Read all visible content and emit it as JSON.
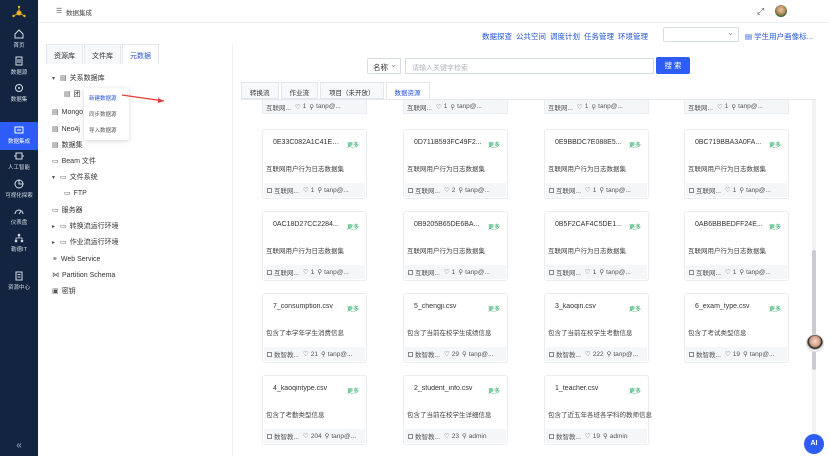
{
  "header": {
    "title": "数据集成"
  },
  "sidebar": {
    "items": [
      {
        "label": "首页",
        "icon": "home-icon"
      },
      {
        "label": "数据源",
        "icon": "database-icon"
      },
      {
        "label": "数据集",
        "icon": "dataset-icon"
      },
      {
        "label": "数据集成",
        "icon": "integration-icon"
      },
      {
        "label": "人工智能",
        "icon": "ai-icon"
      },
      {
        "label": "可视化探索",
        "icon": "chart-icon"
      },
      {
        "label": "仪表盘",
        "icon": "dashboard-icon"
      },
      {
        "label": "勒德IT",
        "icon": "org-icon"
      },
      {
        "label": "资源中心",
        "icon": "resource-icon"
      }
    ],
    "active_index": 3
  },
  "toplinks": [
    "数据探查",
    "公共空间",
    "调度计划",
    "任务管理",
    "环境管理"
  ],
  "profile_link": "学生用户画像标...",
  "left_tabs": [
    "资源库",
    "文件库",
    "元数据"
  ],
  "left_active_tab": 2,
  "tree": {
    "relational": "关系数据库",
    "group_child": "团",
    "mongo": "Mongo",
    "neo4j": "Neo4j",
    "dataset": "数据集",
    "beam": "Beam 文件",
    "filesystem": "文件系统",
    "ftp": "FTP",
    "server": "服务器",
    "convert_env": "转换流运行环境",
    "job_env": "作业流运行环境",
    "web_service": "Web Service",
    "partition_schema": "Partition Schema",
    "key": "密钥"
  },
  "context_menu": [
    "新建数据源",
    "同步数据源",
    "导入数据源"
  ],
  "search": {
    "type": "名称",
    "placeholder": "请输入关键字检索",
    "button": "搜 索"
  },
  "subtabs": [
    "转换流",
    "作业流",
    "项目（未开放）",
    "数据资源"
  ],
  "subtabs_active": 3,
  "top_partial": [
    {
      "owner": "互联网...",
      "likes": "1",
      "user": "tanp@..."
    },
    {
      "owner": "互联网...",
      "likes": "1",
      "user": "tanp@..."
    },
    {
      "owner": "互联网...",
      "likes": "1",
      "user": "tanp@..."
    },
    {
      "owner": "互联网...",
      "likes": "1",
      "user": "tanp@..."
    }
  ],
  "cards": [
    {
      "name": "0E33C082A1C41EF...",
      "more": "更多",
      "desc": "互联网用户行为日志数据集",
      "owner": "互联网...",
      "likes": "1",
      "user": "tanp@..."
    },
    {
      "name": "0D711B593FC49F2...",
      "more": "更多",
      "desc": "互联网用户行为日志数据集",
      "owner": "互联网...",
      "likes": "2",
      "user": "tanp@..."
    },
    {
      "name": "0E9BBDC7E088E5...",
      "more": "更多",
      "desc": "互联网用户行为日志数据集",
      "owner": "互联网...",
      "likes": "1",
      "user": "tanp@..."
    },
    {
      "name": "0BC719BBA3A0FA...",
      "more": "更多",
      "desc": "互联网用户行为日志数据集",
      "owner": "互联网...",
      "likes": "1",
      "user": "tanp@..."
    },
    {
      "name": "0AC18D27CC2284...",
      "more": "更多",
      "desc": "互联网用户行为日志数据集",
      "owner": "互联网...",
      "likes": "1",
      "user": "tanp@..."
    },
    {
      "name": "0B9205B65DE6BA...",
      "more": "更多",
      "desc": "互联网用户行为日志数据集",
      "owner": "互联网...",
      "likes": "1",
      "user": "tanp@..."
    },
    {
      "name": "0B5F2CAF4C5DE1...",
      "more": "更多",
      "desc": "互联网用户行为日志数据集",
      "owner": "互联网...",
      "likes": "1",
      "user": "tanp@..."
    },
    {
      "name": "0AB6BBBEDFF24E...",
      "more": "更多",
      "desc": "互联网用户行为日志数据集",
      "owner": "互联网...",
      "likes": "1",
      "user": "tanp@..."
    },
    {
      "name": "7_consumption.csv",
      "more": "更多",
      "desc": "包含了本学年学生消费信息",
      "owner": "数智教...",
      "likes": "21",
      "user": "tanp@..."
    },
    {
      "name": "5_chengji.csv",
      "more": "更多",
      "desc": "包含了当前在校学生成绩信息",
      "owner": "数智教...",
      "likes": "29",
      "user": "tanp@..."
    },
    {
      "name": "3_kaoqin.csv",
      "more": "更多",
      "desc": "包含了当前在校学生考勤信息",
      "owner": "数智教...",
      "likes": "222",
      "user": "tanp@..."
    },
    {
      "name": "6_exam_type.csv",
      "more": "更多",
      "desc": "包含了考试类型信息",
      "owner": "数智教...",
      "likes": "19",
      "user": "tanp@..."
    },
    {
      "name": "4_kaoqintype.csv",
      "more": "更多",
      "desc": "包含了考勤类型信息",
      "owner": "数智教...",
      "likes": "204",
      "user": "tanp@..."
    },
    {
      "name": "2_student_info.csv",
      "more": "更多",
      "desc": "包含了当前在校学生详细信息",
      "owner": "数智教...",
      "likes": "23",
      "user": "admin"
    },
    {
      "name": "1_teacher.csv",
      "more": "更多",
      "desc": "包含了近五年各班各学科的教师信息",
      "owner": "数智教...",
      "likes": "19",
      "user": "admin"
    }
  ],
  "ai_button": "AI",
  "colors": {
    "sidebar": "#12243f",
    "accent": "#2d5cf6",
    "link": "#2254d6",
    "more": "#19a35a"
  }
}
